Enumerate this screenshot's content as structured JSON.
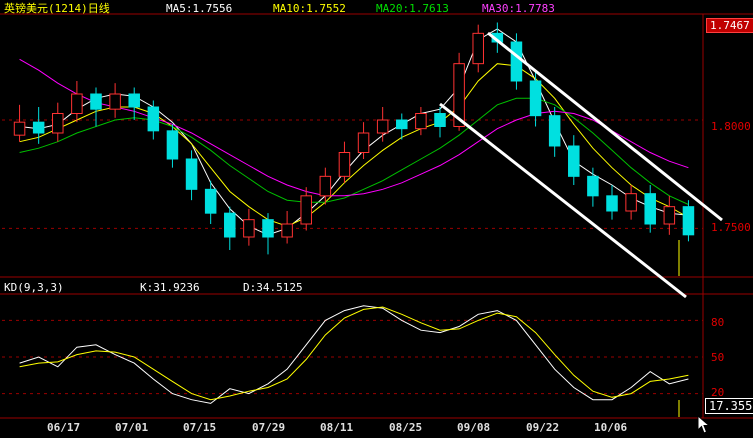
{
  "header": {
    "title": "英镑美元(1214)日线",
    "ma5": "MA5:1.7556",
    "ma10": "MA10:1.7552",
    "ma20": "MA20:1.7613",
    "ma30": "MA30:1.7783"
  },
  "kd_header": {
    "name": "KD(9,3,3)",
    "k": "K:31.9236",
    "d": "D:34.5125"
  },
  "price_axis": {
    "highlight": "1.7467",
    "ticks": [
      "1.8000",
      "1.7500"
    ]
  },
  "kd_axis": {
    "ticks": [
      "80",
      "50",
      "20"
    ],
    "highlight": "17.355"
  },
  "x_axis": {
    "labels": [
      "06/17",
      "07/01",
      "07/15",
      "07/29",
      "08/11",
      "08/25",
      "09/08",
      "09/22",
      "10/06"
    ]
  },
  "colors": {
    "up_candle": "#ff3232",
    "down_candle": "#00e0e0",
    "ma5": "#ffffff",
    "ma10": "#ffff00",
    "ma20": "#00c000",
    "ma30": "#ff00ff",
    "k_line": "#ffffff",
    "d_line": "#ffff00",
    "grid": "#9a0000",
    "trend_channel": "#ffffff"
  },
  "chart_data": [
    {
      "type": "candlestick",
      "title": "英镑美元(1214)日线",
      "ylim": [
        1.728,
        1.848
      ],
      "y_ticks": [
        1.8,
        1.75
      ],
      "series": [
        {
          "name": "MA5:1.7556",
          "values": [
            1.797,
            1.796,
            1.798,
            1.805,
            1.81,
            1.812,
            1.811,
            1.806,
            1.799,
            1.789,
            1.771,
            1.759,
            1.751,
            1.747,
            1.75,
            1.757,
            1.765,
            1.776,
            1.786,
            1.793,
            1.798,
            1.803,
            1.805,
            1.815,
            1.837,
            1.842,
            1.836,
            1.818,
            1.799,
            1.781,
            1.775,
            1.77,
            1.764,
            1.76,
            1.757,
            1.756
          ]
        },
        {
          "name": "MA10:1.7552",
          "values": [
            1.79,
            1.792,
            1.796,
            1.8,
            1.804,
            1.806,
            1.806,
            1.803,
            1.797,
            1.789,
            1.778,
            1.767,
            1.76,
            1.754,
            1.751,
            1.755,
            1.762,
            1.771,
            1.779,
            1.786,
            1.792,
            1.796,
            1.799,
            1.806,
            1.818,
            1.826,
            1.825,
            1.819,
            1.81,
            1.798,
            1.787,
            1.778,
            1.77,
            1.764,
            1.76,
            1.755
          ]
        },
        {
          "name": "MA20:1.7613",
          "values": [
            1.785,
            1.787,
            1.79,
            1.794,
            1.797,
            1.8,
            1.801,
            1.8,
            1.797,
            1.792,
            1.786,
            1.779,
            1.773,
            1.767,
            1.763,
            1.762,
            1.762,
            1.764,
            1.768,
            1.772,
            1.777,
            1.782,
            1.787,
            1.793,
            1.8,
            1.807,
            1.81,
            1.81,
            1.807,
            1.801,
            1.794,
            1.786,
            1.778,
            1.771,
            1.765,
            1.761
          ]
        },
        {
          "name": "MA30:1.7783",
          "values": [
            1.828,
            1.823,
            1.817,
            1.812,
            1.808,
            1.806,
            1.804,
            1.801,
            1.798,
            1.794,
            1.789,
            1.784,
            1.779,
            1.774,
            1.77,
            1.767,
            1.765,
            1.765,
            1.766,
            1.768,
            1.771,
            1.775,
            1.779,
            1.784,
            1.79,
            1.796,
            1.8,
            1.803,
            1.804,
            1.803,
            1.8,
            1.795,
            1.79,
            1.785,
            1.781,
            1.778
          ]
        }
      ],
      "candles": [
        {
          "o": 1.793,
          "c": 1.799,
          "h": 1.807,
          "l": 1.79
        },
        {
          "o": 1.799,
          "c": 1.794,
          "h": 1.806,
          "l": 1.789
        },
        {
          "o": 1.794,
          "c": 1.803,
          "h": 1.808,
          "l": 1.79
        },
        {
          "o": 1.803,
          "c": 1.812,
          "h": 1.818,
          "l": 1.799
        },
        {
          "o": 1.812,
          "c": 1.805,
          "h": 1.815,
          "l": 1.797
        },
        {
          "o": 1.805,
          "c": 1.812,
          "h": 1.817,
          "l": 1.801
        },
        {
          "o": 1.812,
          "c": 1.806,
          "h": 1.815,
          "l": 1.8
        },
        {
          "o": 1.806,
          "c": 1.795,
          "h": 1.809,
          "l": 1.791
        },
        {
          "o": 1.795,
          "c": 1.782,
          "h": 1.798,
          "l": 1.778
        },
        {
          "o": 1.782,
          "c": 1.768,
          "h": 1.786,
          "l": 1.763
        },
        {
          "o": 1.768,
          "c": 1.757,
          "h": 1.772,
          "l": 1.752
        },
        {
          "o": 1.757,
          "c": 1.746,
          "h": 1.76,
          "l": 1.74
        },
        {
          "o": 1.746,
          "c": 1.754,
          "h": 1.759,
          "l": 1.742
        },
        {
          "o": 1.754,
          "c": 1.746,
          "h": 1.757,
          "l": 1.738
        },
        {
          "o": 1.746,
          "c": 1.752,
          "h": 1.758,
          "l": 1.743
        },
        {
          "o": 1.752,
          "c": 1.765,
          "h": 1.769,
          "l": 1.749
        },
        {
          "o": 1.765,
          "c": 1.774,
          "h": 1.778,
          "l": 1.761
        },
        {
          "o": 1.774,
          "c": 1.785,
          "h": 1.79,
          "l": 1.771
        },
        {
          "o": 1.785,
          "c": 1.794,
          "h": 1.799,
          "l": 1.782
        },
        {
          "o": 1.794,
          "c": 1.8,
          "h": 1.806,
          "l": 1.79
        },
        {
          "o": 1.8,
          "c": 1.796,
          "h": 1.803,
          "l": 1.791
        },
        {
          "o": 1.796,
          "c": 1.803,
          "h": 1.806,
          "l": 1.793
        },
        {
          "o": 1.803,
          "c": 1.797,
          "h": 1.806,
          "l": 1.792
        },
        {
          "o": 1.797,
          "c": 1.826,
          "h": 1.831,
          "l": 1.795
        },
        {
          "o": 1.826,
          "c": 1.84,
          "h": 1.844,
          "l": 1.822
        },
        {
          "o": 1.84,
          "c": 1.836,
          "h": 1.845,
          "l": 1.831
        },
        {
          "o": 1.836,
          "c": 1.818,
          "h": 1.84,
          "l": 1.814
        },
        {
          "o": 1.818,
          "c": 1.802,
          "h": 1.822,
          "l": 1.797
        },
        {
          "o": 1.802,
          "c": 1.788,
          "h": 1.806,
          "l": 1.783
        },
        {
          "o": 1.788,
          "c": 1.774,
          "h": 1.793,
          "l": 1.77
        },
        {
          "o": 1.774,
          "c": 1.765,
          "h": 1.778,
          "l": 1.76
        },
        {
          "o": 1.765,
          "c": 1.758,
          "h": 1.77,
          "l": 1.754
        },
        {
          "o": 1.758,
          "c": 1.766,
          "h": 1.77,
          "l": 1.754
        },
        {
          "o": 1.766,
          "c": 1.752,
          "h": 1.77,
          "l": 1.748
        },
        {
          "o": 1.752,
          "c": 1.76,
          "h": 1.765,
          "l": 1.747
        },
        {
          "o": 1.76,
          "c": 1.747,
          "h": 1.763,
          "l": 1.744
        }
      ]
    },
    {
      "type": "line",
      "title": "KD(9,3,3)",
      "ylim": [
        0,
        100
      ],
      "y_ticks": [
        80,
        50,
        20
      ],
      "series": [
        {
          "name": "K:31.9236",
          "values": [
            45,
            50,
            42,
            58,
            60,
            52,
            45,
            32,
            20,
            15,
            12,
            24,
            20,
            28,
            40,
            60,
            80,
            88,
            92,
            90,
            80,
            72,
            70,
            75,
            85,
            88,
            80,
            60,
            40,
            25,
            15,
            15,
            25,
            38,
            28,
            32
          ]
        },
        {
          "name": "D:34.5125",
          "values": [
            42,
            45,
            46,
            52,
            55,
            54,
            50,
            40,
            30,
            20,
            15,
            18,
            22,
            25,
            32,
            48,
            68,
            82,
            89,
            91,
            85,
            78,
            72,
            73,
            80,
            86,
            83,
            70,
            52,
            35,
            22,
            17,
            20,
            30,
            32,
            35
          ]
        }
      ]
    }
  ]
}
